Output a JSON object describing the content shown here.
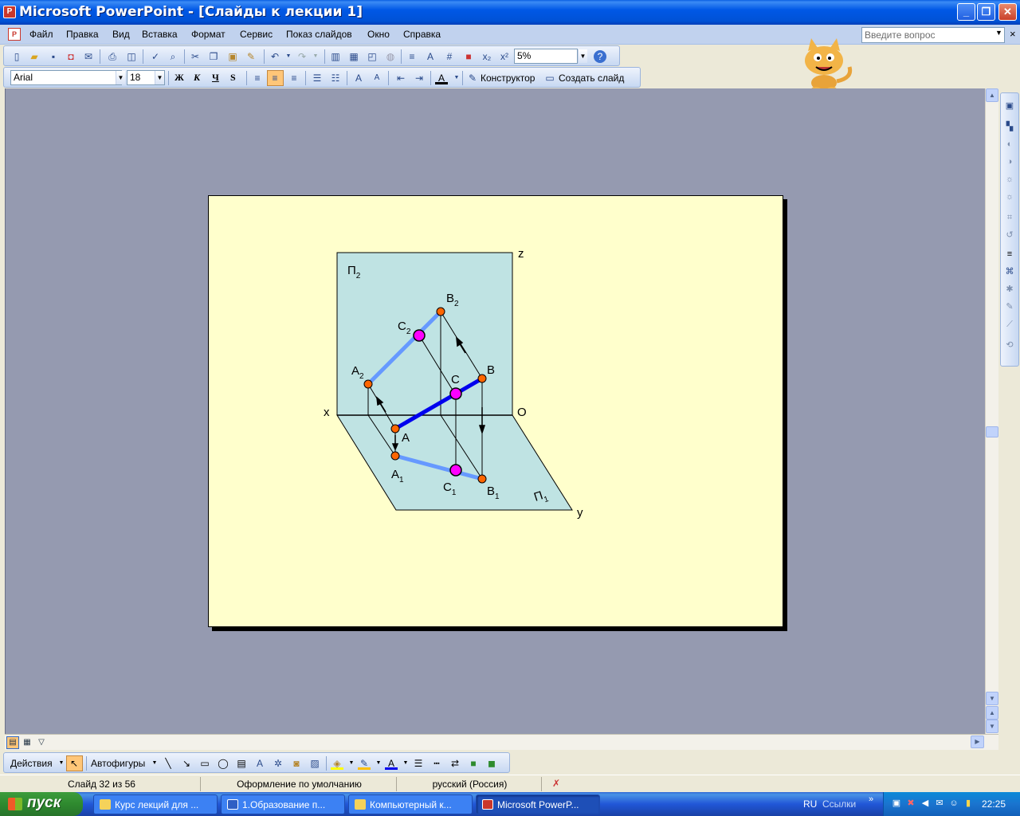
{
  "window": {
    "title": "Microsoft PowerPoint - [Слайды к лекции 1]",
    "minimize": "_",
    "maximize": "❐",
    "close": "✕"
  },
  "menu": {
    "items": [
      "Файл",
      "Правка",
      "Вид",
      "Вставка",
      "Формат",
      "Сервис",
      "Показ слайдов",
      "Окно",
      "Справка"
    ],
    "help_placeholder": "Введите вопрос",
    "close_glyph": "×"
  },
  "toolbar_standard": {
    "zoom": "5%"
  },
  "toolbar_formatting": {
    "font_name": "Arial",
    "font_size": "18",
    "bold": "Ж",
    "italic": "К",
    "underline": "Ч",
    "shadow": "S",
    "designer": "Конструктор",
    "new_slide": "Создать слайд"
  },
  "slide": {
    "labels": {
      "plane_v": "П",
      "plane_v_sub": "2",
      "plane_h": "П",
      "plane_h_sub": "1",
      "axis_z": "z",
      "axis_x": "x",
      "axis_y": "y",
      "origin": "O",
      "A": "A",
      "B": "B",
      "C": "C",
      "A2": "A",
      "A2_sub": "2",
      "B2": "B",
      "B2_sub": "2",
      "C2": "C",
      "C2_sub": "2",
      "A1": "A",
      "A1_sub": "1",
      "B1": "B",
      "B1_sub": "1",
      "C1": "C",
      "C1_sub": "1"
    },
    "colors": {
      "background": "#ffffcc",
      "plane": "#bfe3e3",
      "segment_space": "#0000ee",
      "segment_projection": "#6699ff",
      "point_fill": "#ff6600",
      "midpoint_fill": "#ff00ff"
    }
  },
  "drawing_toolbar": {
    "actions": "Действия",
    "autoshapes": "Автофигуры"
  },
  "status": {
    "slide_counter": "Слайд 32 из 56",
    "design": "Оформление по умолчанию",
    "language": "русский (Россия)"
  },
  "taskbar": {
    "start": "пуск",
    "tasks": [
      {
        "label": "Курс лекций для ..."
      },
      {
        "label": "1.Образование п..."
      },
      {
        "label": "Компьютерный к..."
      },
      {
        "label": "Microsoft PowerP..."
      }
    ],
    "lang": "RU",
    "links": "Ссылки",
    "links_arrow": "»",
    "clock": "22:25"
  }
}
